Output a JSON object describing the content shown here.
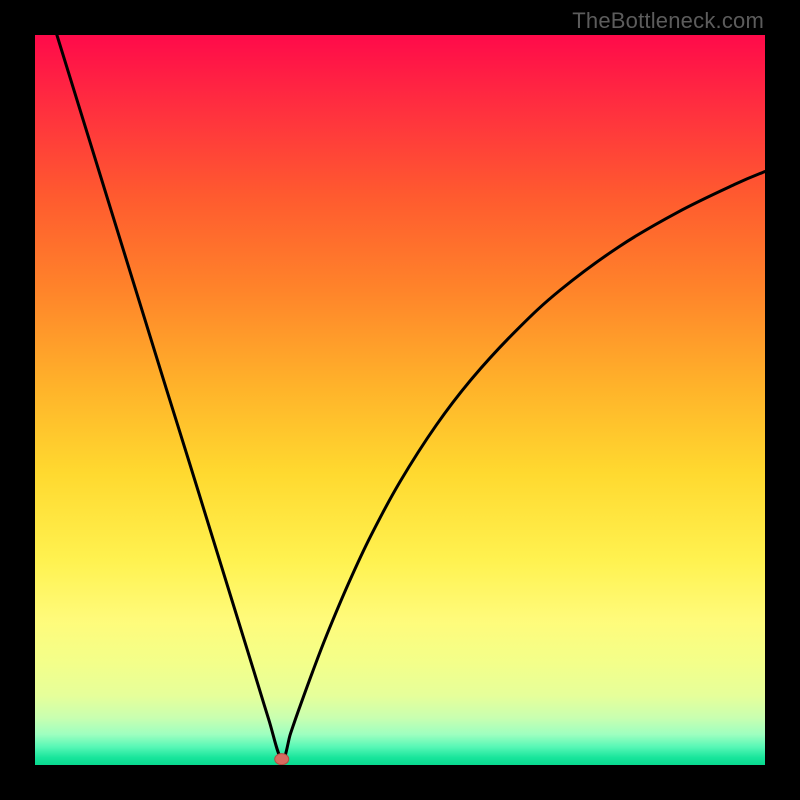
{
  "watermark": "TheBottleneck.com",
  "colors": {
    "frame": "#000000",
    "curve": "#000000",
    "marker_fill": "#d86b60",
    "marker_stroke": "#b54d43",
    "gradient_stops": [
      {
        "offset": 0.0,
        "color": "#ff0a4a"
      },
      {
        "offset": 0.1,
        "color": "#ff2f3f"
      },
      {
        "offset": 0.22,
        "color": "#ff5a2f"
      },
      {
        "offset": 0.35,
        "color": "#ff842a"
      },
      {
        "offset": 0.48,
        "color": "#ffb22a"
      },
      {
        "offset": 0.6,
        "color": "#ffd92f"
      },
      {
        "offset": 0.72,
        "color": "#fff250"
      },
      {
        "offset": 0.8,
        "color": "#fffb7a"
      },
      {
        "offset": 0.86,
        "color": "#f3ff8a"
      },
      {
        "offset": 0.905,
        "color": "#e6ff9a"
      },
      {
        "offset": 0.935,
        "color": "#c9ffb0"
      },
      {
        "offset": 0.958,
        "color": "#9effc0"
      },
      {
        "offset": 0.975,
        "color": "#58f7b6"
      },
      {
        "offset": 0.99,
        "color": "#18e59b"
      },
      {
        "offset": 1.0,
        "color": "#08d98f"
      }
    ]
  },
  "chart_data": {
    "type": "line",
    "title": "",
    "xlabel": "",
    "ylabel": "",
    "xlim": [
      0,
      100
    ],
    "ylim": [
      0,
      100
    ],
    "grid": false,
    "legend": false,
    "marker": {
      "x": 33.8,
      "y": 0.8
    },
    "series": [
      {
        "name": "curve",
        "x": [
          3,
          6,
          9,
          12,
          15,
          18,
          21,
          24,
          27,
          30,
          32,
          33.8,
          35,
          36,
          38,
          40,
          43,
          46,
          50,
          55,
          60,
          66,
          72,
          80,
          88,
          96,
          100
        ],
        "values": [
          100,
          90.3,
          80.6,
          70.9,
          61.2,
          51.5,
          41.9,
          32.2,
          22.5,
          12.8,
          6.3,
          0.8,
          4.3,
          7.2,
          12.7,
          17.9,
          25.0,
          31.4,
          38.8,
          46.6,
          53.1,
          59.6,
          65.1,
          71.0,
          75.7,
          79.6,
          81.3
        ]
      }
    ]
  }
}
